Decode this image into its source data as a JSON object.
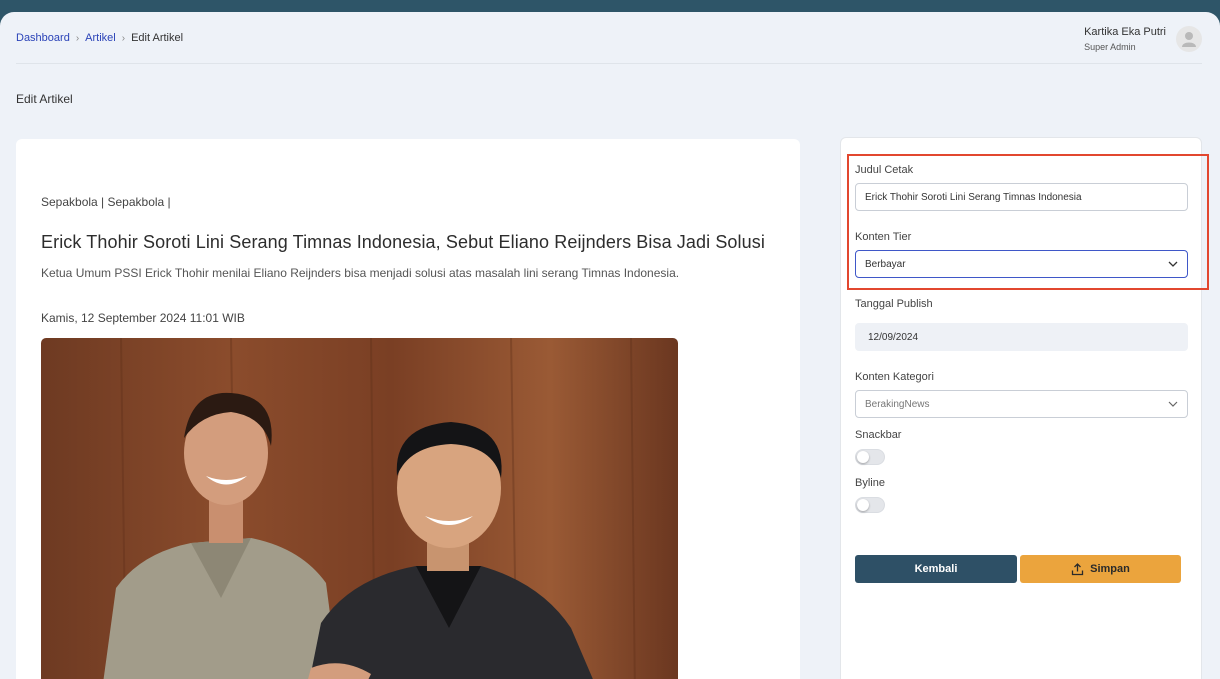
{
  "breadcrumb": {
    "items": [
      "Dashboard",
      "Artikel"
    ],
    "current": "Edit Artikel"
  },
  "user": {
    "name": "Kartika Eka Putri",
    "role": "Super Admin"
  },
  "page": {
    "title": "Edit Artikel"
  },
  "article": {
    "category": "Sepakbola | Sepakbola |",
    "headline": "Erick Thohir Soroti Lini Serang Timnas Indonesia, Sebut Eliano Reijnders Bisa Jadi Solusi",
    "lead": "Ketua Umum PSSI Erick Thohir menilai Eliano Reijnders bisa menjadi solusi atas masalah lini serang Timnas Indonesia.",
    "date": "Kamis, 12 September 2024 11:01 WIB"
  },
  "form": {
    "judul_cetak": {
      "label": "Judul Cetak",
      "value": "Erick Thohir Soroti Lini Serang Timnas Indonesia"
    },
    "konten_tier": {
      "label": "Konten Tier",
      "value": "Berbayar"
    },
    "tanggal_publish": {
      "label": "Tanggal Publish",
      "value": "12/09/2024"
    },
    "konten_kategori": {
      "label": "Konten Kategori",
      "value": "BerakingNews"
    },
    "snackbar": {
      "label": "Snackbar",
      "on": false
    },
    "byline": {
      "label": "Byline",
      "on": false
    },
    "back_label": "Kembali",
    "save_label": "Simpan"
  },
  "colors": {
    "header_bg": "#2e5568",
    "primary_button": "#2e5066",
    "save_button": "#eba43d",
    "link": "#2b43b8",
    "highlight_border": "#e2472f"
  }
}
